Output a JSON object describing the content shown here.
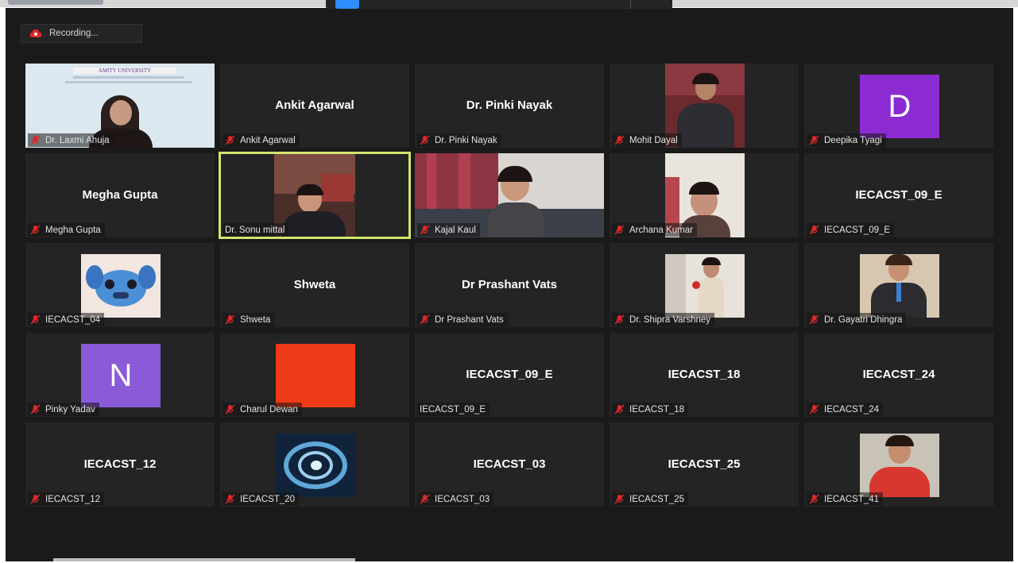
{
  "recording": {
    "label": "Recording..."
  },
  "colors": {
    "active_speaker_border": "#d3e46d",
    "muted_icon": "#e02828",
    "avatar_purple": "#8c2bd2",
    "avatar_purple_light": "#8a5ad8",
    "orange_tile": "#ee3a17"
  },
  "participants": [
    {
      "id": "p1",
      "label": "Dr. Laxmi Ahuja",
      "center_name": "",
      "muted": true,
      "type": "video"
    },
    {
      "id": "p2",
      "label": "Ankit Agarwal",
      "center_name": "Ankit Agarwal",
      "muted": true,
      "type": "name"
    },
    {
      "id": "p3",
      "label": "Dr. Pinki Nayak",
      "center_name": "Dr. Pinki Nayak",
      "muted": true,
      "type": "name"
    },
    {
      "id": "p4",
      "label": "Mohit Dayal",
      "center_name": "",
      "muted": true,
      "type": "video"
    },
    {
      "id": "p5",
      "label": "Deepika Tyagi",
      "center_name": "",
      "muted": true,
      "type": "avatar",
      "initial": "D"
    },
    {
      "id": "p6",
      "label": "Megha Gupta",
      "center_name": "Megha Gupta",
      "muted": true,
      "type": "name"
    },
    {
      "id": "p7",
      "label": "Dr. Sonu mittal",
      "center_name": "",
      "muted": false,
      "type": "video",
      "active": true
    },
    {
      "id": "p8",
      "label": "Kajal Kaul",
      "center_name": "",
      "muted": true,
      "type": "video"
    },
    {
      "id": "p9",
      "label": "Archana Kumar",
      "center_name": "",
      "muted": true,
      "type": "video"
    },
    {
      "id": "p10",
      "label": "IECACST_09_E",
      "center_name": "IECACST_09_E",
      "muted": true,
      "type": "name"
    },
    {
      "id": "p11",
      "label": "IECACST_04",
      "center_name": "",
      "muted": true,
      "type": "image"
    },
    {
      "id": "p12",
      "label": "Shweta",
      "center_name": "Shweta",
      "muted": true,
      "type": "name"
    },
    {
      "id": "p13",
      "label": "Dr Prashant Vats",
      "center_name": "Dr Prashant Vats",
      "muted": true,
      "type": "name"
    },
    {
      "id": "p14",
      "label": "Dr. Shipra Varshney",
      "center_name": "",
      "muted": true,
      "type": "video"
    },
    {
      "id": "p15",
      "label": "Dr. Gayatri Dhingra",
      "center_name": "",
      "muted": true,
      "type": "video"
    },
    {
      "id": "p16",
      "label": "Pinky Yadav",
      "center_name": "",
      "muted": true,
      "type": "avatar",
      "initial": "N"
    },
    {
      "id": "p17",
      "label": "Charul Dewan",
      "center_name": "",
      "muted": true,
      "type": "image"
    },
    {
      "id": "p18",
      "label": "IECACST_09_E",
      "center_name": "IECACST_09_E",
      "muted": false,
      "type": "name"
    },
    {
      "id": "p19",
      "label": "IECACST_18",
      "center_name": "IECACST_18",
      "muted": true,
      "type": "name"
    },
    {
      "id": "p20",
      "label": "IECACST_24",
      "center_name": "IECACST_24",
      "muted": true,
      "type": "name"
    },
    {
      "id": "p21",
      "label": "IECACST_12",
      "center_name": "IECACST_12",
      "muted": true,
      "type": "name"
    },
    {
      "id": "p22",
      "label": "IECACST_20",
      "center_name": "",
      "muted": true,
      "type": "image"
    },
    {
      "id": "p23",
      "label": "IECACST_03",
      "center_name": "IECACST_03",
      "muted": true,
      "type": "name"
    },
    {
      "id": "p24",
      "label": "IECACST_25",
      "center_name": "IECACST_25",
      "muted": true,
      "type": "name"
    },
    {
      "id": "p25",
      "label": "IECACST_41",
      "center_name": "",
      "muted": true,
      "type": "video"
    }
  ],
  "slide": {
    "header": "AMITY UNIVERSITY"
  }
}
